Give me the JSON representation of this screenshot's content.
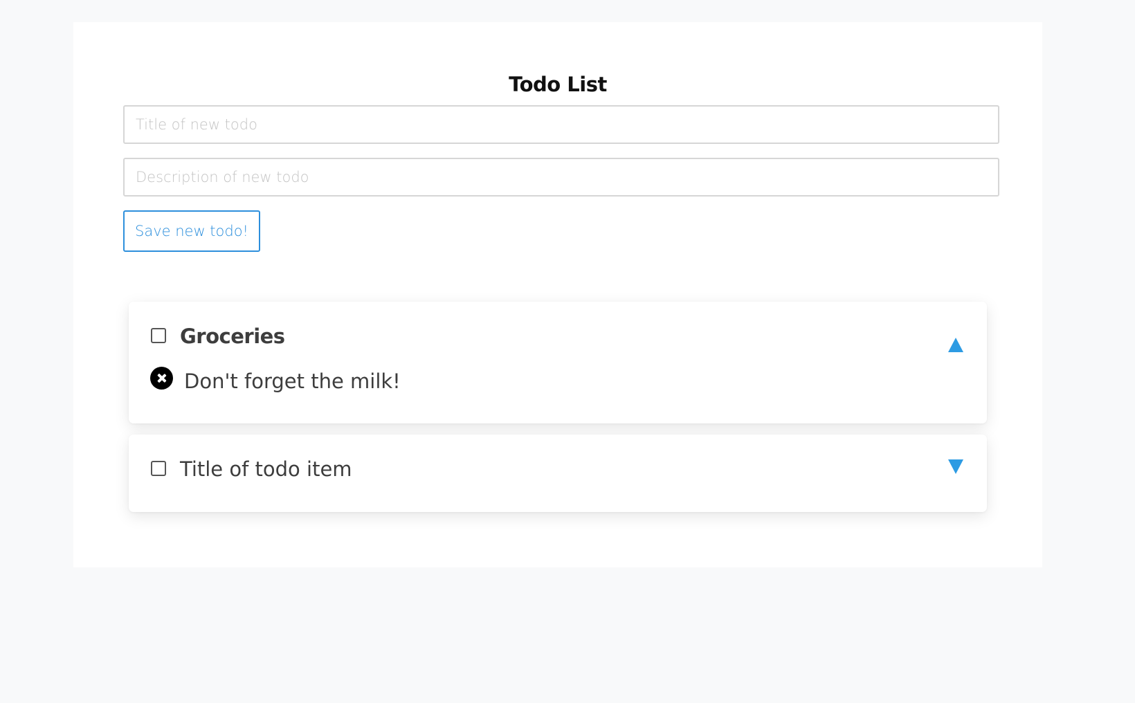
{
  "header": {
    "title": "Todo List"
  },
  "form": {
    "title_placeholder": "Title of new todo",
    "title_value": "",
    "description_placeholder": "Description of new todo",
    "description_value": "",
    "save_label": "Save new todo!"
  },
  "todos": [
    {
      "title": "Groceries",
      "description": "Don't forget the milk!",
      "checked": false,
      "expanded": true,
      "toggle_icon": "chevron-up-icon"
    },
    {
      "title": "Title of todo item",
      "checked": false,
      "expanded": false,
      "toggle_icon": "chevron-down-icon"
    }
  ],
  "colors": {
    "accent": "#2d8fdc",
    "arrow": "#2d9be3",
    "background": "#f8f9fa",
    "panel": "#ffffff"
  }
}
